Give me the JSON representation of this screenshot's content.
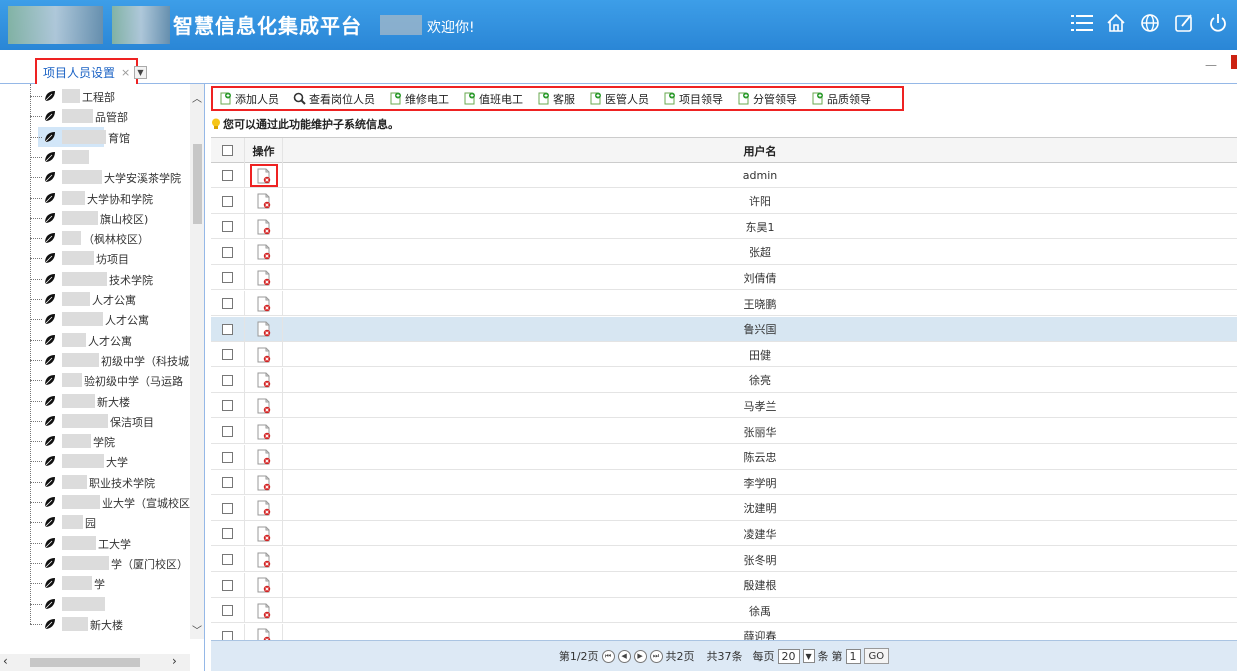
{
  "header": {
    "title": "智慧信息化集成平台",
    "welcome": "欢迎你!",
    "icons": [
      "menu-icon",
      "home-icon",
      "globe-icon",
      "edit-icon",
      "power-icon"
    ]
  },
  "tabs": [
    {
      "label": "项目人员设置",
      "close": "×",
      "active": true
    }
  ],
  "tree": {
    "items": [
      {
        "label": "工程部"
      },
      {
        "label": "品管部"
      },
      {
        "label": "育馆",
        "selected": true
      },
      {
        "label": ""
      },
      {
        "label": "大学安溪茶学院"
      },
      {
        "label": "大学协和学院"
      },
      {
        "label": "旗山校区)"
      },
      {
        "label": "（枫林校区）"
      },
      {
        "label": "坊项目"
      },
      {
        "label": "技术学院"
      },
      {
        "label": "人才公寓"
      },
      {
        "label": "人才公寓"
      },
      {
        "label": "人才公寓"
      },
      {
        "label": "初级中学（科技城"
      },
      {
        "label": "验初级中学（马运路"
      },
      {
        "label": "新大楼"
      },
      {
        "label": "保洁项目"
      },
      {
        "label": "学院"
      },
      {
        "label": "大学"
      },
      {
        "label": "职业技术学院"
      },
      {
        "label": "业大学（宣城校区）"
      },
      {
        "label": "园"
      },
      {
        "label": "工大学"
      },
      {
        "label": "学（厦门校区）"
      },
      {
        "label": "学"
      },
      {
        "label": ""
      },
      {
        "label": "新大楼"
      }
    ]
  },
  "toolbar": {
    "buttons": [
      {
        "label": "添加人员",
        "icon": "add-doc-icon"
      },
      {
        "label": "查看岗位人员",
        "icon": "search-icon"
      },
      {
        "label": "维修电工",
        "icon": "add-doc-icon"
      },
      {
        "label": "值班电工",
        "icon": "add-doc-icon"
      },
      {
        "label": "客服",
        "icon": "add-doc-icon"
      },
      {
        "label": "医管人员",
        "icon": "add-doc-icon"
      },
      {
        "label": "项目领导",
        "icon": "add-doc-icon"
      },
      {
        "label": "分管领导",
        "icon": "add-doc-icon"
      },
      {
        "label": "品质领导",
        "icon": "add-doc-icon"
      }
    ]
  },
  "info": {
    "text": "您可以通过此功能维护子系统信息。"
  },
  "grid": {
    "columns": {
      "op": "操作",
      "name": "用户名"
    },
    "rows": [
      {
        "name": "admin"
      },
      {
        "name": "许阳"
      },
      {
        "name": "东昊1"
      },
      {
        "name": "张超"
      },
      {
        "name": "刘倩倩"
      },
      {
        "name": "王晓鹏"
      },
      {
        "name": "鲁兴国",
        "highlight": true
      },
      {
        "name": "田健"
      },
      {
        "name": "徐亮"
      },
      {
        "name": "马孝兰"
      },
      {
        "name": "张丽华"
      },
      {
        "name": "陈云忠"
      },
      {
        "name": "李学明"
      },
      {
        "name": "沈建明"
      },
      {
        "name": "凌建华"
      },
      {
        "name": "张冬明"
      },
      {
        "name": "殷建根"
      },
      {
        "name": "徐禹"
      },
      {
        "name": "薛迎春"
      }
    ]
  },
  "pager": {
    "page_text": "第1/2页",
    "total_pages": "共2页",
    "total_records": "共37条",
    "per_page_label": "每页",
    "per_page": "20",
    "per_page_unit": "条",
    "goto_label": "第",
    "goto_value": "1",
    "go": "GO"
  },
  "colors": {
    "header": "#2a86d6",
    "highlight_row": "#d7e6f2",
    "annotation_red": "#e22222"
  }
}
